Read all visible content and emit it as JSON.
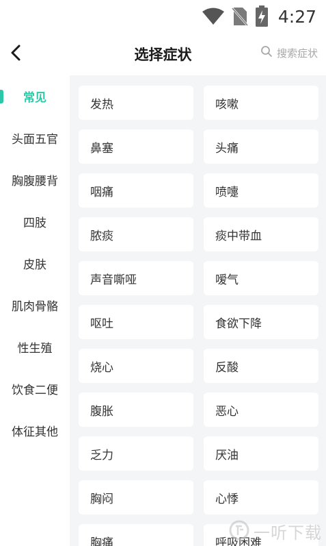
{
  "status_bar": {
    "time": "4:27"
  },
  "header": {
    "title": "选择症状",
    "search_label": "搜索症状"
  },
  "sidebar": {
    "items": [
      {
        "label": "常见",
        "active": true
      },
      {
        "label": "头面五官",
        "active": false
      },
      {
        "label": "胸腹腰背",
        "active": false
      },
      {
        "label": "四肢",
        "active": false
      },
      {
        "label": "皮肤",
        "active": false
      },
      {
        "label": "肌肉骨骼",
        "active": false
      },
      {
        "label": "性生殖",
        "active": false
      },
      {
        "label": "饮食二便",
        "active": false
      },
      {
        "label": "体征其他",
        "active": false
      }
    ]
  },
  "symptoms": [
    "发热",
    "咳嗽",
    "鼻塞",
    "头痛",
    "咽痛",
    "喷嚏",
    "脓痰",
    "痰中带血",
    "声音嘶哑",
    "嗳气",
    "呕吐",
    "食欲下降",
    "烧心",
    "反酸",
    "腹胀",
    "恶心",
    "乏力",
    "厌油",
    "胸闷",
    "心悸",
    "胸痛",
    "呼吸困难"
  ],
  "watermark": {
    "text": "一听下载"
  },
  "colors": {
    "accent": "#2cc7a8",
    "content_bg": "#f4f5f7"
  }
}
